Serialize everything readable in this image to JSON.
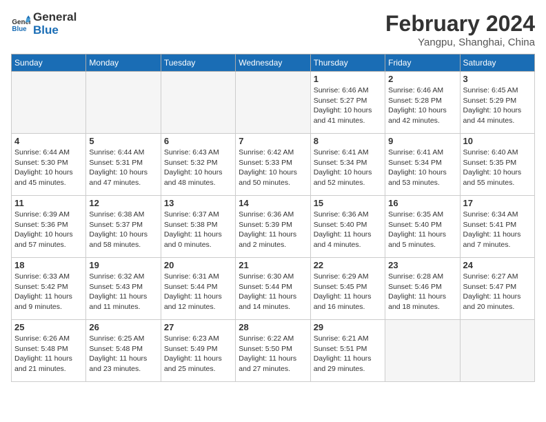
{
  "header": {
    "logo_line1": "General",
    "logo_line2": "Blue",
    "month_year": "February 2024",
    "location": "Yangpu, Shanghai, China"
  },
  "weekdays": [
    "Sunday",
    "Monday",
    "Tuesday",
    "Wednesday",
    "Thursday",
    "Friday",
    "Saturday"
  ],
  "weeks": [
    [
      {
        "day": "",
        "info": ""
      },
      {
        "day": "",
        "info": ""
      },
      {
        "day": "",
        "info": ""
      },
      {
        "day": "",
        "info": ""
      },
      {
        "day": "1",
        "info": "Sunrise: 6:46 AM\nSunset: 5:27 PM\nDaylight: 10 hours\nand 41 minutes."
      },
      {
        "day": "2",
        "info": "Sunrise: 6:46 AM\nSunset: 5:28 PM\nDaylight: 10 hours\nand 42 minutes."
      },
      {
        "day": "3",
        "info": "Sunrise: 6:45 AM\nSunset: 5:29 PM\nDaylight: 10 hours\nand 44 minutes."
      }
    ],
    [
      {
        "day": "4",
        "info": "Sunrise: 6:44 AM\nSunset: 5:30 PM\nDaylight: 10 hours\nand 45 minutes."
      },
      {
        "day": "5",
        "info": "Sunrise: 6:44 AM\nSunset: 5:31 PM\nDaylight: 10 hours\nand 47 minutes."
      },
      {
        "day": "6",
        "info": "Sunrise: 6:43 AM\nSunset: 5:32 PM\nDaylight: 10 hours\nand 48 minutes."
      },
      {
        "day": "7",
        "info": "Sunrise: 6:42 AM\nSunset: 5:33 PM\nDaylight: 10 hours\nand 50 minutes."
      },
      {
        "day": "8",
        "info": "Sunrise: 6:41 AM\nSunset: 5:34 PM\nDaylight: 10 hours\nand 52 minutes."
      },
      {
        "day": "9",
        "info": "Sunrise: 6:41 AM\nSunset: 5:34 PM\nDaylight: 10 hours\nand 53 minutes."
      },
      {
        "day": "10",
        "info": "Sunrise: 6:40 AM\nSunset: 5:35 PM\nDaylight: 10 hours\nand 55 minutes."
      }
    ],
    [
      {
        "day": "11",
        "info": "Sunrise: 6:39 AM\nSunset: 5:36 PM\nDaylight: 10 hours\nand 57 minutes."
      },
      {
        "day": "12",
        "info": "Sunrise: 6:38 AM\nSunset: 5:37 PM\nDaylight: 10 hours\nand 58 minutes."
      },
      {
        "day": "13",
        "info": "Sunrise: 6:37 AM\nSunset: 5:38 PM\nDaylight: 11 hours\nand 0 minutes."
      },
      {
        "day": "14",
        "info": "Sunrise: 6:36 AM\nSunset: 5:39 PM\nDaylight: 11 hours\nand 2 minutes."
      },
      {
        "day": "15",
        "info": "Sunrise: 6:36 AM\nSunset: 5:40 PM\nDaylight: 11 hours\nand 4 minutes."
      },
      {
        "day": "16",
        "info": "Sunrise: 6:35 AM\nSunset: 5:40 PM\nDaylight: 11 hours\nand 5 minutes."
      },
      {
        "day": "17",
        "info": "Sunrise: 6:34 AM\nSunset: 5:41 PM\nDaylight: 11 hours\nand 7 minutes."
      }
    ],
    [
      {
        "day": "18",
        "info": "Sunrise: 6:33 AM\nSunset: 5:42 PM\nDaylight: 11 hours\nand 9 minutes."
      },
      {
        "day": "19",
        "info": "Sunrise: 6:32 AM\nSunset: 5:43 PM\nDaylight: 11 hours\nand 11 minutes."
      },
      {
        "day": "20",
        "info": "Sunrise: 6:31 AM\nSunset: 5:44 PM\nDaylight: 11 hours\nand 12 minutes."
      },
      {
        "day": "21",
        "info": "Sunrise: 6:30 AM\nSunset: 5:44 PM\nDaylight: 11 hours\nand 14 minutes."
      },
      {
        "day": "22",
        "info": "Sunrise: 6:29 AM\nSunset: 5:45 PM\nDaylight: 11 hours\nand 16 minutes."
      },
      {
        "day": "23",
        "info": "Sunrise: 6:28 AM\nSunset: 5:46 PM\nDaylight: 11 hours\nand 18 minutes."
      },
      {
        "day": "24",
        "info": "Sunrise: 6:27 AM\nSunset: 5:47 PM\nDaylight: 11 hours\nand 20 minutes."
      }
    ],
    [
      {
        "day": "25",
        "info": "Sunrise: 6:26 AM\nSunset: 5:48 PM\nDaylight: 11 hours\nand 21 minutes."
      },
      {
        "day": "26",
        "info": "Sunrise: 6:25 AM\nSunset: 5:48 PM\nDaylight: 11 hours\nand 23 minutes."
      },
      {
        "day": "27",
        "info": "Sunrise: 6:23 AM\nSunset: 5:49 PM\nDaylight: 11 hours\nand 25 minutes."
      },
      {
        "day": "28",
        "info": "Sunrise: 6:22 AM\nSunset: 5:50 PM\nDaylight: 11 hours\nand 27 minutes."
      },
      {
        "day": "29",
        "info": "Sunrise: 6:21 AM\nSunset: 5:51 PM\nDaylight: 11 hours\nand 29 minutes."
      },
      {
        "day": "",
        "info": ""
      },
      {
        "day": "",
        "info": ""
      }
    ]
  ]
}
